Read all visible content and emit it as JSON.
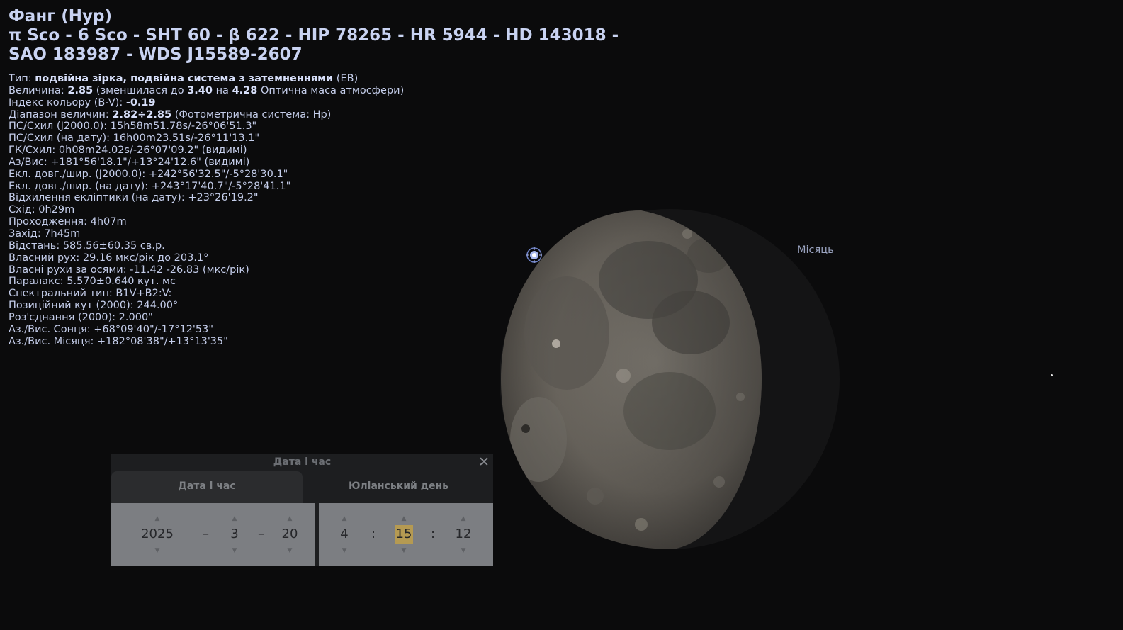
{
  "object": {
    "title": "Фанг (Нур)",
    "designations": "π Sco - 6 Sco - SHT 60 - β 622 - HIP 78265 - HR 5944 - HD 143018 - SAO 183987 - WDS J15589-2607"
  },
  "info": {
    "type_label": "Тип: ",
    "type_value": "подвійна зірка, подвійна система з затемненнями",
    "type_suffix": " (EB)",
    "mag_label": "Величина: ",
    "mag_value": "2.85",
    "mag_mid1": " (зменшилася до ",
    "mag_ext": "3.40",
    "mag_mid2": " на ",
    "mag_airmass": "4.28",
    "mag_tail": " Оптична маса атмосфери)",
    "bv_label": "Індекс кольору (B-V): ",
    "bv_value": "-0.19",
    "range_label": "Діапазон величин: ",
    "range_value": "2.82÷2.85",
    "range_tail": " (Фотометрична система: Hp)",
    "lines": [
      "ПС/Схил (J2000.0): 15h58m51.78s/-26°06'51.3\"",
      "ПС/Схил (на дату): 16h00m23.51s/-26°11'13.1\"",
      "ГК/Схил: 0h08m24.02s/-26°07'09.2\" (видимі)",
      "Аз/Вис: +181°56'18.1\"/+13°24'12.6\" (видимі)",
      "Екл. довг./шир. (J2000.0): +242°56'32.5\"/-5°28'30.1\"",
      "Екл. довг./шир. (на дату): +243°17'40.7\"/-5°28'41.1\"",
      "Відхилення екліптики (на дату): +23°26'19.2\"",
      "Схід: 0h29m",
      "Проходження: 4h07m",
      "Захід: 7h45m",
      "Відстань: 585.56±60.35 св.р.",
      "Власний рух: 29.16 мкс/рік до 203.1°",
      "Власні рухи за осями: -11.42 -26.83 (мкс/рік)",
      "Паралакс: 5.570±0.640 кут. мс",
      "Спектральний тип: B1V+B2:V:",
      "Позиційний кут (2000): 244.00°",
      "Роз'єднання (2000): 2.000\"",
      "Аз./Вис. Сонця: +68°09'40\"/-17°12'53\"",
      "Аз./Вис. Місяця: +182°08'38\"/+13°13'35\""
    ]
  },
  "sky": {
    "moon_label": "Місяць",
    "colors": {
      "background": "#0b0b0c",
      "text": "#c4cdea",
      "highlight": "#b59a52"
    },
    "icons": [
      "selected-star-marker-icon",
      "moon-image"
    ]
  },
  "datetime_dialog": {
    "title": "Дата і час",
    "close": "✕",
    "tabs": [
      "Дата і час",
      "Юліанський день"
    ],
    "date": {
      "year": "2025",
      "month": "3",
      "day": "20",
      "sep": "–"
    },
    "time": {
      "hour": "4",
      "minute": "15",
      "second": "12",
      "sep": ":"
    },
    "spin_up": "▲",
    "spin_down": "▼"
  }
}
